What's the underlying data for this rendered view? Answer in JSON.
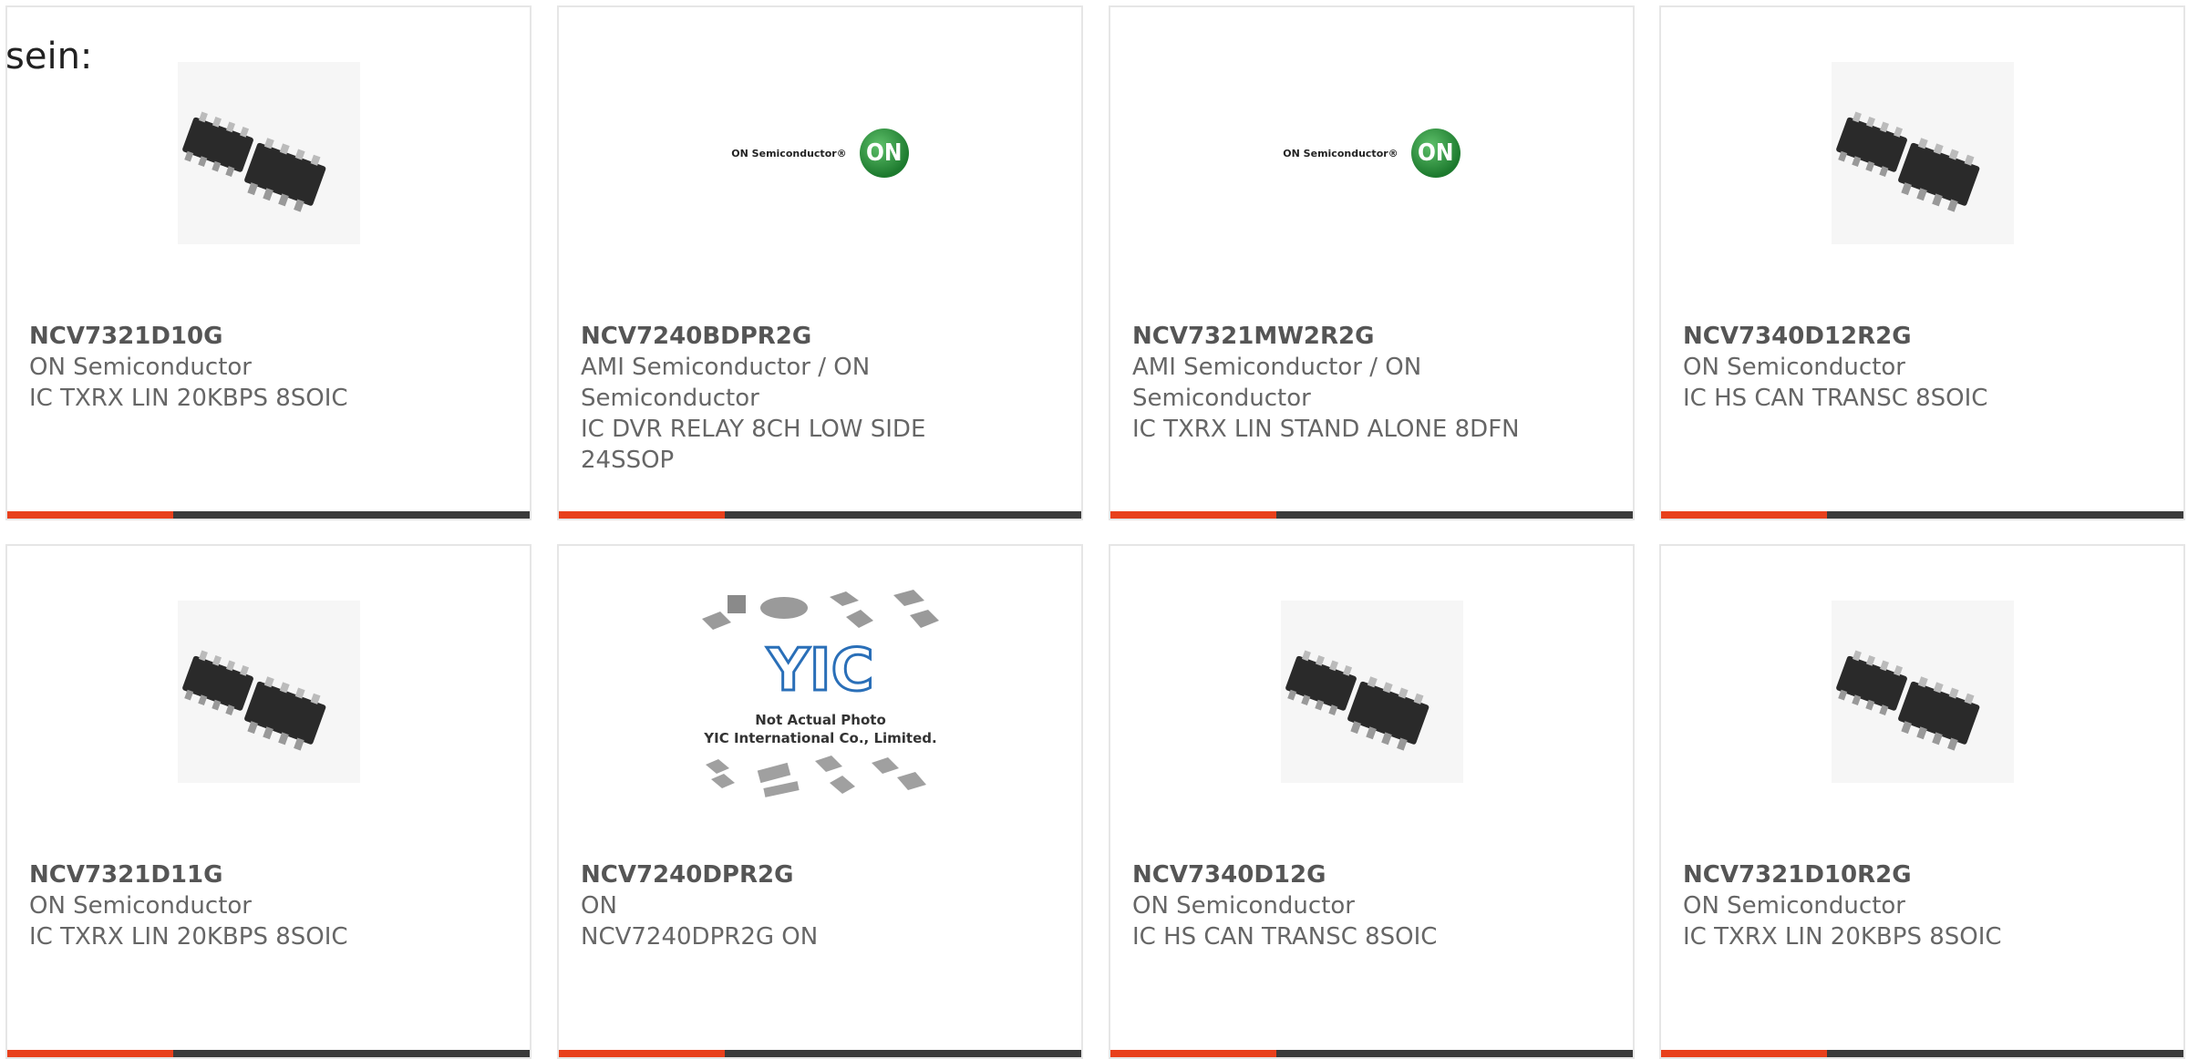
{
  "heading": "sein:",
  "accent_color": "#e8401c",
  "bar_color": "#3b3b3b",
  "cards": [
    {
      "part": "NCV7321D10G",
      "lines": [
        "ON Semiconductor",
        "IC TXRX LIN 20KBPS 8SOIC"
      ],
      "image": "soic8-chip-photo"
    },
    {
      "part": "NCV7240BDPR2G",
      "lines": [
        "AMI Semiconductor / ON",
        "Semiconductor",
        "IC DVR RELAY 8CH LOW SIDE",
        "24SSOP"
      ],
      "image": "on-semiconductor-logo"
    },
    {
      "part": "NCV7321MW2R2G",
      "lines": [
        "AMI Semiconductor / ON",
        "Semiconductor",
        "IC TXRX LIN STAND ALONE 8DFN"
      ],
      "image": "on-semiconductor-logo"
    },
    {
      "part": "NCV7340D12R2G",
      "lines": [
        "ON Semiconductor",
        "IC HS CAN TRANSC 8SOIC"
      ],
      "image": "soic8-chip-photo"
    },
    {
      "part": "NCV7321D11G",
      "lines": [
        "ON Semiconductor",
        "IC TXRX LIN 20KBPS 8SOIC"
      ],
      "image": "soic8-chip-photo"
    },
    {
      "part": "NCV7240DPR2G",
      "lines": [
        "ON",
        "NCV7240DPR2G ON"
      ],
      "image": "yic-placeholder",
      "placeholder_text": [
        "Not Actual Photo",
        "YIC International Co., Limited."
      ]
    },
    {
      "part": "NCV7340D12G",
      "lines": [
        "ON Semiconductor",
        "IC HS CAN TRANSC 8SOIC"
      ],
      "image": "soic8-chip-photo"
    },
    {
      "part": "NCV7321D10R2G",
      "lines": [
        "ON Semiconductor",
        "IC TXRX LIN 20KBPS 8SOIC"
      ],
      "image": "soic8-chip-photo"
    }
  ],
  "logo_text": "ON Semiconductor®",
  "logo_badge": "ON",
  "yic_mark": "YIC"
}
